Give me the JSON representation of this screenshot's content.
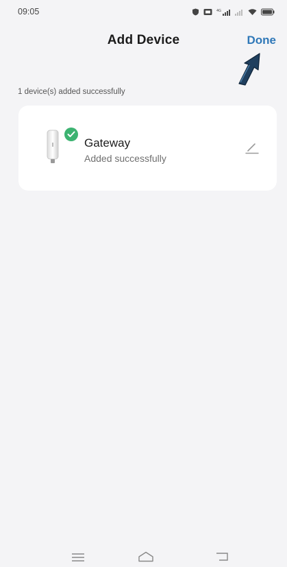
{
  "status_bar": {
    "time": "09:05",
    "icons": [
      "shield-icon",
      "nfc-icon",
      "signal-icon",
      "wifi-icon",
      "battery-icon"
    ]
  },
  "header": {
    "title": "Add Device",
    "done_label": "Done",
    "accent_color": "#2f78b8"
  },
  "section_label": "1 device(s) added successfully",
  "device": {
    "name": "Gateway",
    "status": "Added successfully",
    "badge_color": "#3cb371",
    "icon": "gateway-device-icon"
  },
  "nav_bar": {
    "items": [
      "menu-icon",
      "home-icon",
      "back-icon"
    ]
  }
}
